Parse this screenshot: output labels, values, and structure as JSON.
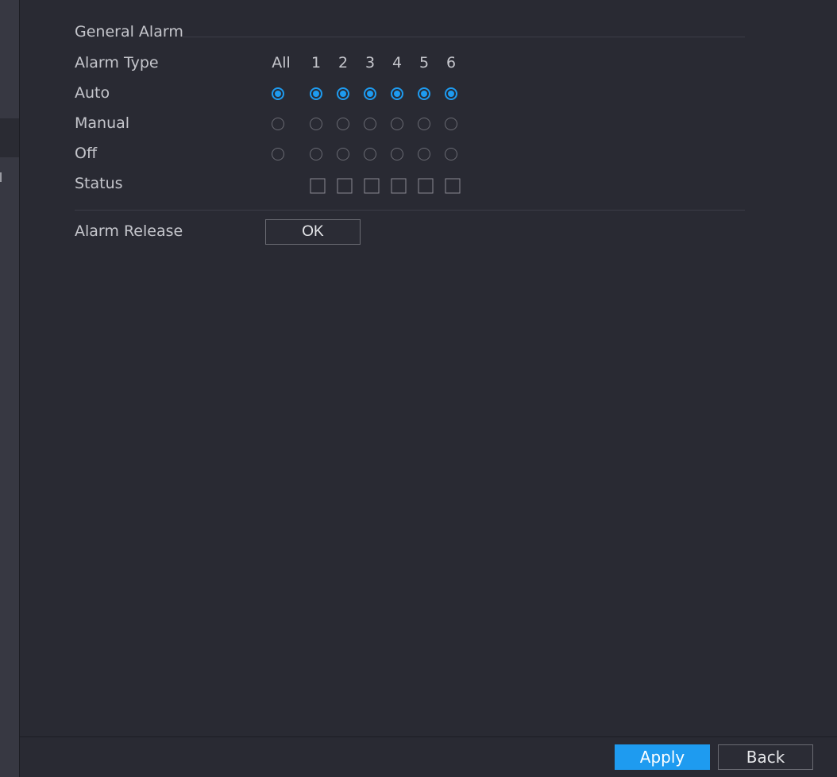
{
  "general_alarm": {
    "section_title": "General Alarm",
    "header_label": "Alarm Type",
    "columns": [
      "All",
      "1",
      "2",
      "3",
      "4",
      "5",
      "6"
    ],
    "rows": {
      "auto": {
        "label": "Auto",
        "selected": true
      },
      "manual": {
        "label": "Manual",
        "selected": false
      },
      "off": {
        "label": "Off",
        "selected": false
      }
    },
    "status_label": "Status",
    "status_channels": [
      "1",
      "2",
      "3",
      "4",
      "5",
      "6"
    ]
  },
  "alarm_release": {
    "label": "Alarm Release",
    "button_label": "OK"
  },
  "footer": {
    "apply_label": "Apply",
    "back_label": "Back"
  },
  "colors": {
    "accent": "#1e9bf0",
    "background": "#292a33",
    "sidebar": "#373842"
  }
}
